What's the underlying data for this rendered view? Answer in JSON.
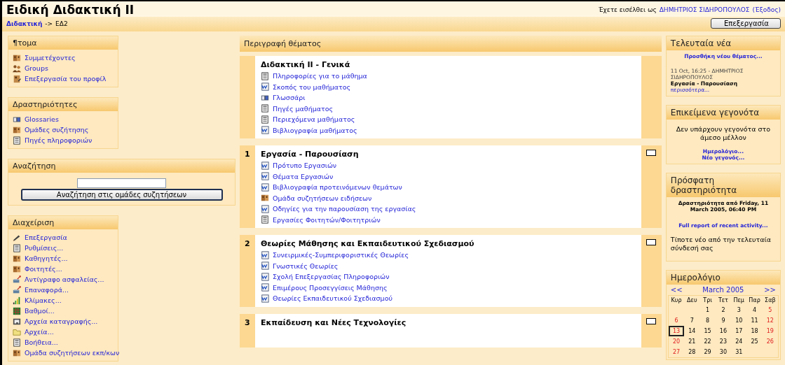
{
  "header": {
    "title": "Ειδική Διδακτική II",
    "login_text": "Έχετε εισέλθει ως",
    "user": "ΔΗΜΗΤΡΙΟΣ ΣΙΔΗΡΟΠΟΥΛΟΣ",
    "logout": "(Έξοδος)"
  },
  "breadcrumb": {
    "link": "Διδακτική",
    "separator": "->",
    "current": "ΕΔ2"
  },
  "edit_button": "Επεξεργασία",
  "left_blocks": [
    {
      "kind": "links",
      "title": "¶τομα",
      "items": [
        {
          "kind": "people",
          "label": "Συμμετέχοντες"
        },
        {
          "kind": "groups",
          "label": "Groups"
        },
        {
          "kind": "profile",
          "label": "Επεξεργασία του προφίλ"
        }
      ]
    },
    {
      "kind": "links",
      "title": "Δραστηριότητες",
      "items": [
        {
          "kind": "glossary",
          "label": "Glossaries"
        },
        {
          "kind": "people",
          "label": "Ομάδες συζήτησης"
        },
        {
          "kind": "page",
          "label": "Πηγές πληροφοριών"
        }
      ]
    },
    {
      "kind": "search",
      "title": "Αναζήτηση",
      "button": "Αναζήτηση στις ομάδες συζητήσεων"
    },
    {
      "kind": "links",
      "title": "Διαχείριση",
      "items": [
        {
          "kind": "edit",
          "label": "Επεξεργασία"
        },
        {
          "kind": "page",
          "label": "Ρυθμίσεις..."
        },
        {
          "kind": "people",
          "label": "Καθηγητές..."
        },
        {
          "kind": "people",
          "label": "Φοιτητές..."
        },
        {
          "kind": "backup",
          "label": "Αντίγραφο ασφαλείας..."
        },
        {
          "kind": "backup",
          "label": "Επαναφορά..."
        },
        {
          "kind": "scales",
          "label": "Κλίμακες..."
        },
        {
          "kind": "grades",
          "label": "Βαθμοί..."
        },
        {
          "kind": "logs",
          "label": "Αρχεία καταγραφής..."
        },
        {
          "kind": "folder",
          "label": "Αρχεία..."
        },
        {
          "kind": "page",
          "label": "Βοήθεια..."
        },
        {
          "kind": "people",
          "label": "Ομάδα συζητήσεων εκπ/κων"
        }
      ]
    }
  ],
  "topics_header": "Περιγραφή θέματος",
  "sections": [
    {
      "title": "Διδακτική II - Γενικά",
      "marker": false,
      "items": [
        {
          "kind": "page",
          "label": "Πληροφορίες για το μάθημα"
        },
        {
          "kind": "word",
          "label": "Σκοπός του μαθήματος"
        },
        {
          "kind": "glossary",
          "label": "Γλωσσάρι"
        },
        {
          "kind": "page",
          "label": "Πηγές μαθήματος"
        },
        {
          "kind": "page",
          "label": "Περιεχόμενα μαθήματος"
        },
        {
          "kind": "word",
          "label": "Βιβλιογραφία μαθήματος"
        }
      ]
    },
    {
      "number": "1",
      "title": "Εργασία - Παρουσίαση",
      "marker": true,
      "items": [
        {
          "kind": "word",
          "label": "Πρότυπο Εργασιών"
        },
        {
          "kind": "word",
          "label": "Θέματα Εργασιών"
        },
        {
          "kind": "word",
          "label": "Βιβλιογραφία προτεινόμενων θεμάτων"
        },
        {
          "kind": "people",
          "label": "Ομάδα συζητήσεων ειδήσεων"
        },
        {
          "kind": "word",
          "label": "Οδηγίες για την παρουσίαση της εργασίας"
        },
        {
          "kind": "page",
          "label": "Εργασίες Φοιτητών/Φοιτητριών"
        }
      ]
    },
    {
      "number": "2",
      "title": "Θεωρίες Μάθησης και Εκπαιδευτικού Σχεδιασμού",
      "marker": true,
      "items": [
        {
          "kind": "word",
          "label": "Συνειρμικές-Συμπεριφοριστικές Θεωρίες"
        },
        {
          "kind": "word",
          "label": "Γνωστικές Θεωρίες"
        },
        {
          "kind": "word",
          "label": "Σχολή Επεξεργασίας Πληροφοριών"
        },
        {
          "kind": "word",
          "label": "Επιμέρους Προσεγγίσεις Μάθησης"
        },
        {
          "kind": "word",
          "label": "Θεωρίες Εκπαιδευτικού Σχεδιασμού"
        }
      ]
    },
    {
      "number": "3",
      "title": "Εκπαίδευση και Νέες Τεχνολογίες",
      "marker": true
    }
  ],
  "news": {
    "title": "Τελευταία νέα",
    "add_link": "Προσθήκη νέου θέματος...",
    "post_meta": "11 Oct, 16:25 - ΔΗΜΗΤΡΙΟΣ ΣΙΔΗΡΟΠΟΥΛΟΣ",
    "post_subject": "Εργασία - Παρουσίαση",
    "more": "περισσότερα..."
  },
  "events": {
    "title": "Επικείμενα γεγονότα",
    "text": "Δεν υπάρχουν γεγονότα στο άμεσο μέλλον",
    "links": [
      "Ημερολόγιο...",
      "Νέο γεγονός..."
    ]
  },
  "recent": {
    "title": "Πρόσφατη δραστηριότητα",
    "since": "Δραστηριότητα από Friday, 11 March 2005, 06:40 PM",
    "link": "Full report of recent activity...",
    "nothing": "Τίποτε νέο από την τελευταία σύνδεσή σας"
  },
  "calendar": {
    "title": "Ημερολόγιο",
    "prev": "<<",
    "month": "March 2005",
    "next": ">>",
    "weekdays": [
      "Κυρ",
      "Δευ",
      "Τρι",
      "Τετ",
      "Πεμ",
      "Παρ",
      "Σαβ"
    ],
    "weeks": [
      [
        {
          "d": "1",
          "today": false
        },
        {
          "d": "2",
          "today": false
        },
        {
          "d": "3",
          "today": false
        },
        {
          "d": "4",
          "today": false
        },
        {
          "d": "5",
          "today": false
        }
      ],
      [
        {
          "d": "6",
          "today": false
        },
        {
          "d": "7",
          "today": false
        },
        {
          "d": "8",
          "today": false
        },
        {
          "d": "9",
          "today": false
        },
        {
          "d": "10",
          "today": false
        },
        {
          "d": "11",
          "today": false
        },
        {
          "d": "12",
          "today": false
        }
      ],
      [
        {
          "d": "13",
          "today": true
        },
        {
          "d": "14",
          "today": false
        },
        {
          "d": "15",
          "today": false
        },
        {
          "d": "16",
          "today": false
        },
        {
          "d": "17",
          "today": false
        },
        {
          "d": "18",
          "today": false
        },
        {
          "d": "19",
          "today": false
        }
      ],
      [
        {
          "d": "20",
          "today": false
        },
        {
          "d": "21",
          "today": false
        },
        {
          "d": "22",
          "today": false
        },
        {
          "d": "23",
          "today": false
        },
        {
          "d": "24",
          "today": false
        },
        {
          "d": "25",
          "today": false
        },
        {
          "d": "26",
          "today": false
        }
      ],
      [
        {
          "d": "27",
          "today": false
        },
        {
          "d": "28",
          "today": false
        },
        {
          "d": "29",
          "today": false
        },
        {
          "d": "30",
          "today": false
        },
        {
          "d": "31",
          "today": false
        }
      ]
    ]
  }
}
